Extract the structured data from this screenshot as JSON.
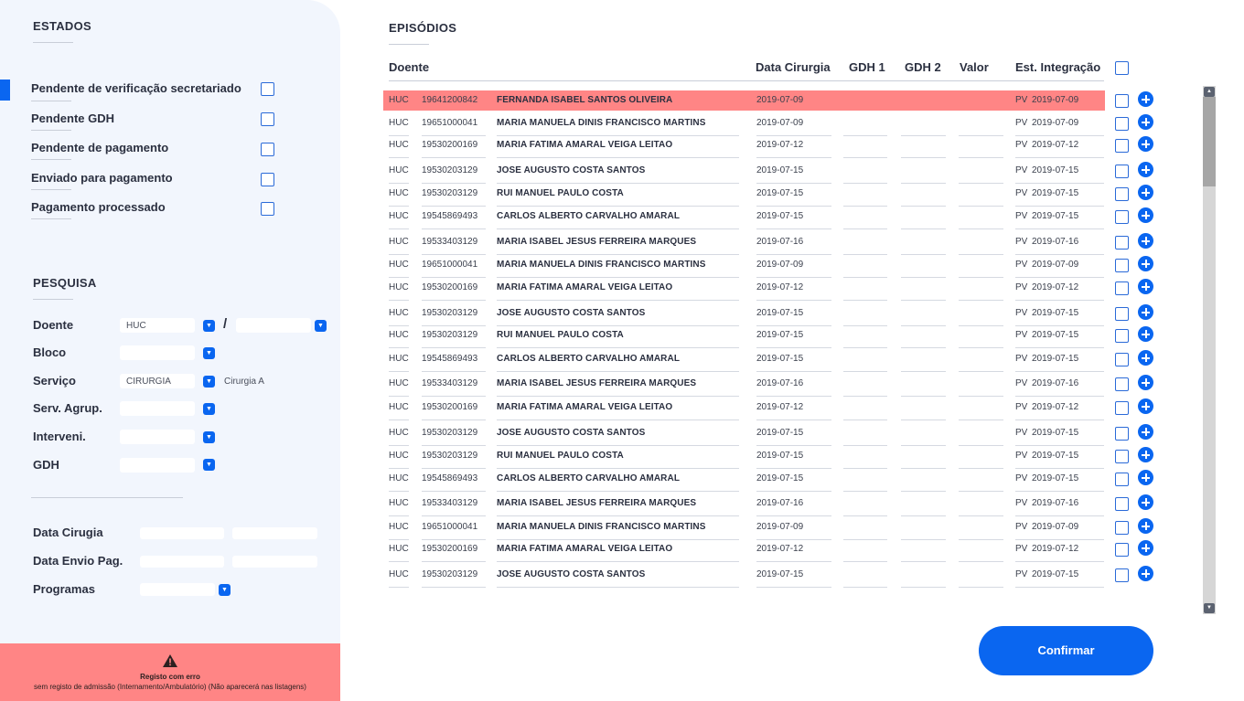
{
  "sidebar": {
    "estados_title": "ESTADOS",
    "estados": [
      {
        "label": "Pendente de verificação secretariado",
        "active": true
      },
      {
        "label": "Pendente GDH",
        "active": false
      },
      {
        "label": "Pendente de pagamento",
        "active": false
      },
      {
        "label": "Enviado para pagamento",
        "active": false
      },
      {
        "label": "Pagamento processado",
        "active": false
      }
    ],
    "pesquisa_title": "PESQUISA",
    "fields": {
      "doente": {
        "label": "Doente",
        "value": "HUC",
        "value2": "",
        "separator": "/"
      },
      "bloco": {
        "label": "Bloco",
        "value": ""
      },
      "servico": {
        "label": "Serviço",
        "value": "CIRURGIA",
        "extra": "Cirurgia A"
      },
      "serv_agrup": {
        "label": "Serv. Agrup.",
        "value": ""
      },
      "interveni": {
        "label": "Interveni.",
        "value": ""
      },
      "gdh": {
        "label": "GDH",
        "value": ""
      },
      "data_cirugia": {
        "label": "Data Cirugia",
        "from": "",
        "to": ""
      },
      "data_envio": {
        "label": "Data Envio Pag.",
        "from": "",
        "to": ""
      },
      "programas": {
        "label": "Programas",
        "value": ""
      }
    },
    "error": {
      "title": "Registo com erro",
      "text": "sem registo de admissão (Internamento/Ambulatório) (Não aparecerá nas listagens)",
      "icon": "warning-icon"
    }
  },
  "main": {
    "title": "EPISÓDIOS",
    "columns": {
      "doente": "Doente",
      "data_cirurgia": "Data Cirurgia",
      "gdh1": "GDH 1",
      "gdh2": "GDH 2",
      "valor": "Valor",
      "est_integracao": "Est. Integração"
    },
    "rows": [
      {
        "hosp": "HUC",
        "num": "19641200842",
        "name": "FERNANDA ISABEL SANTOS OLIVEIRA",
        "date": "2019-07-09",
        "gdh1": "",
        "gdh2": "",
        "valor": "",
        "est": "PV",
        "est_date": "2019-07-09",
        "highlight": true
      },
      {
        "hosp": "HUC",
        "num": "19651000041",
        "name": "MARIA MANUELA DINIS FRANCISCO MARTINS",
        "date": "2019-07-09",
        "gdh1": "",
        "gdh2": "",
        "valor": "",
        "est": "PV",
        "est_date": "2019-07-09",
        "highlight": false
      },
      {
        "hosp": "HUC",
        "num": "19530200169",
        "name": "MARIA FATIMA AMARAL VEIGA LEITAO",
        "date": "2019-07-12",
        "gdh1": "",
        "gdh2": "",
        "valor": "",
        "est": "PV",
        "est_date": "2019-07-12",
        "highlight": false
      },
      {
        "hosp": "HUC",
        "num": "19530203129",
        "name": "JOSE AUGUSTO COSTA SANTOS",
        "date": "2019-07-15",
        "gdh1": "",
        "gdh2": "",
        "valor": "",
        "est": "PV",
        "est_date": "2019-07-15",
        "highlight": false
      },
      {
        "hosp": "HUC",
        "num": "19530203129",
        "name": "RUI MANUEL PAULO COSTA",
        "date": "2019-07-15",
        "gdh1": "",
        "gdh2": "",
        "valor": "",
        "est": "PV",
        "est_date": "2019-07-15",
        "highlight": false
      },
      {
        "hosp": "HUC",
        "num": "19545869493",
        "name": "CARLOS ALBERTO CARVALHO AMARAL",
        "date": "2019-07-15",
        "gdh1": "",
        "gdh2": "",
        "valor": "",
        "est": "PV",
        "est_date": "2019-07-15",
        "highlight": false
      },
      {
        "hosp": "HUC",
        "num": "19533403129",
        "name": "MARIA ISABEL JESUS FERREIRA MARQUES",
        "date": "2019-07-16",
        "gdh1": "",
        "gdh2": "",
        "valor": "",
        "est": "PV",
        "est_date": "2019-07-16",
        "highlight": false
      },
      {
        "hosp": "HUC",
        "num": "19651000041",
        "name": "MARIA MANUELA DINIS FRANCISCO MARTINS",
        "date": "2019-07-09",
        "gdh1": "",
        "gdh2": "",
        "valor": "",
        "est": "PV",
        "est_date": "2019-07-09",
        "highlight": false
      },
      {
        "hosp": "HUC",
        "num": "19530200169",
        "name": "MARIA FATIMA AMARAL VEIGA LEITAO",
        "date": "2019-07-12",
        "gdh1": "",
        "gdh2": "",
        "valor": "",
        "est": "PV",
        "est_date": "2019-07-12",
        "highlight": false
      },
      {
        "hosp": "HUC",
        "num": "19530203129",
        "name": "JOSE AUGUSTO COSTA SANTOS",
        "date": "2019-07-15",
        "gdh1": "",
        "gdh2": "",
        "valor": "",
        "est": "PV",
        "est_date": "2019-07-15",
        "highlight": false
      },
      {
        "hosp": "HUC",
        "num": "19530203129",
        "name": "RUI MANUEL PAULO COSTA",
        "date": "2019-07-15",
        "gdh1": "",
        "gdh2": "",
        "valor": "",
        "est": "PV",
        "est_date": "2019-07-15",
        "highlight": false
      },
      {
        "hosp": "HUC",
        "num": "19545869493",
        "name": "CARLOS ALBERTO CARVALHO AMARAL",
        "date": "2019-07-15",
        "gdh1": "",
        "gdh2": "",
        "valor": "",
        "est": "PV",
        "est_date": "2019-07-15",
        "highlight": false
      },
      {
        "hosp": "HUC",
        "num": "19533403129",
        "name": "MARIA ISABEL JESUS FERREIRA MARQUES",
        "date": "2019-07-16",
        "gdh1": "",
        "gdh2": "",
        "valor": "",
        "est": "PV",
        "est_date": "2019-07-16",
        "highlight": false
      },
      {
        "hosp": "HUC",
        "num": "19530200169",
        "name": "MARIA FATIMA AMARAL VEIGA LEITAO",
        "date": "2019-07-12",
        "gdh1": "",
        "gdh2": "",
        "valor": "",
        "est": "PV",
        "est_date": "2019-07-12",
        "highlight": false
      },
      {
        "hosp": "HUC",
        "num": "19530203129",
        "name": "JOSE AUGUSTO COSTA SANTOS",
        "date": "2019-07-15",
        "gdh1": "",
        "gdh2": "",
        "valor": "",
        "est": "PV",
        "est_date": "2019-07-15",
        "highlight": false
      },
      {
        "hosp": "HUC",
        "num": "19530203129",
        "name": "RUI MANUEL PAULO COSTA",
        "date": "2019-07-15",
        "gdh1": "",
        "gdh2": "",
        "valor": "",
        "est": "PV",
        "est_date": "2019-07-15",
        "highlight": false
      },
      {
        "hosp": "HUC",
        "num": "19545869493",
        "name": "CARLOS ALBERTO CARVALHO AMARAL",
        "date": "2019-07-15",
        "gdh1": "",
        "gdh2": "",
        "valor": "",
        "est": "PV",
        "est_date": "2019-07-15",
        "highlight": false
      },
      {
        "hosp": "HUC",
        "num": "19533403129",
        "name": "MARIA ISABEL JESUS FERREIRA MARQUES",
        "date": "2019-07-16",
        "gdh1": "",
        "gdh2": "",
        "valor": "",
        "est": "PV",
        "est_date": "2019-07-16",
        "highlight": false
      },
      {
        "hosp": "HUC",
        "num": "19651000041",
        "name": "MARIA MANUELA DINIS FRANCISCO MARTINS",
        "date": "2019-07-09",
        "gdh1": "",
        "gdh2": "",
        "valor": "",
        "est": "PV",
        "est_date": "2019-07-09",
        "highlight": false
      },
      {
        "hosp": "HUC",
        "num": "19530200169",
        "name": "MARIA FATIMA AMARAL VEIGA LEITAO",
        "date": "2019-07-12",
        "gdh1": "",
        "gdh2": "",
        "valor": "",
        "est": "PV",
        "est_date": "2019-07-12",
        "highlight": false
      },
      {
        "hosp": "HUC",
        "num": "19530203129",
        "name": "JOSE AUGUSTO COSTA SANTOS",
        "date": "2019-07-15",
        "gdh1": "",
        "gdh2": "",
        "valor": "",
        "est": "PV",
        "est_date": "2019-07-15",
        "highlight": false
      }
    ],
    "confirm_label": "Confirmar"
  },
  "colors": {
    "accent": "#0a66f0",
    "error": "#ff8585",
    "sidebar_bg": "#f2f6fd",
    "text": "#2b3040"
  }
}
